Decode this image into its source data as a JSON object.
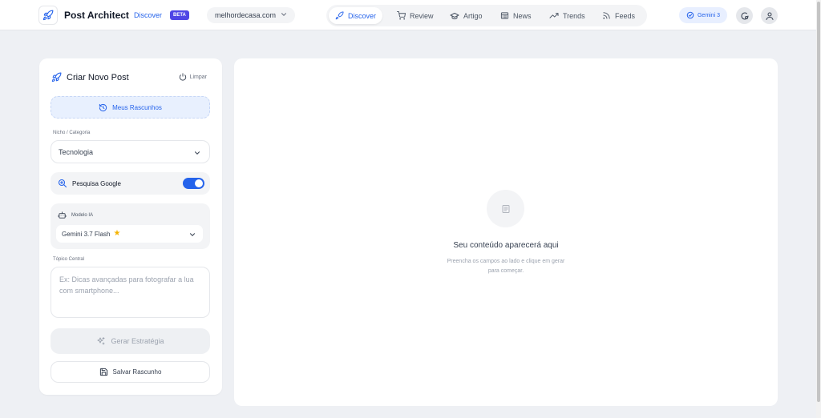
{
  "header": {
    "brand": "Post Architect",
    "brand_sub": "Discover",
    "badge": "BETA",
    "site": "melhordecasa.com",
    "nav": [
      {
        "label": "Discover",
        "icon": "rocket-icon"
      },
      {
        "label": "Review",
        "icon": "cart-icon"
      },
      {
        "label": "Artigo",
        "icon": "graduation-cap-icon"
      },
      {
        "label": "News",
        "icon": "newspaper-icon"
      },
      {
        "label": "Trends",
        "icon": "trending-icon"
      },
      {
        "label": "Feeds",
        "icon": "rss-icon"
      }
    ],
    "model_pill": "Gemini 3",
    "colors": {
      "accent": "#2563eb",
      "badge": "#4f46e5"
    }
  },
  "panel": {
    "title": "Criar Novo Post",
    "clear_label": "Limpar",
    "drafts_label": "Meus Rascunhos",
    "niche_label": "Nicho / Categoria",
    "niche_value": "Tecnologia",
    "google_label": "Pesquisa Google",
    "google_enabled": true,
    "model_label": "Modelo IA",
    "model_value": "Gemini 3.7 Flash",
    "topic_label": "Tópico Central",
    "topic_placeholder": "Ex: Dicas avançadas para fotografar a lua com smartphone...",
    "generate_label": "Gerar Estratégia",
    "save_label": "Salvar Rascunho"
  },
  "content": {
    "empty_title": "Seu conteúdo aparecerá aqui",
    "empty_line1": "Preencha os campos ao lado e clique em gerar",
    "empty_line2": "para começar."
  }
}
